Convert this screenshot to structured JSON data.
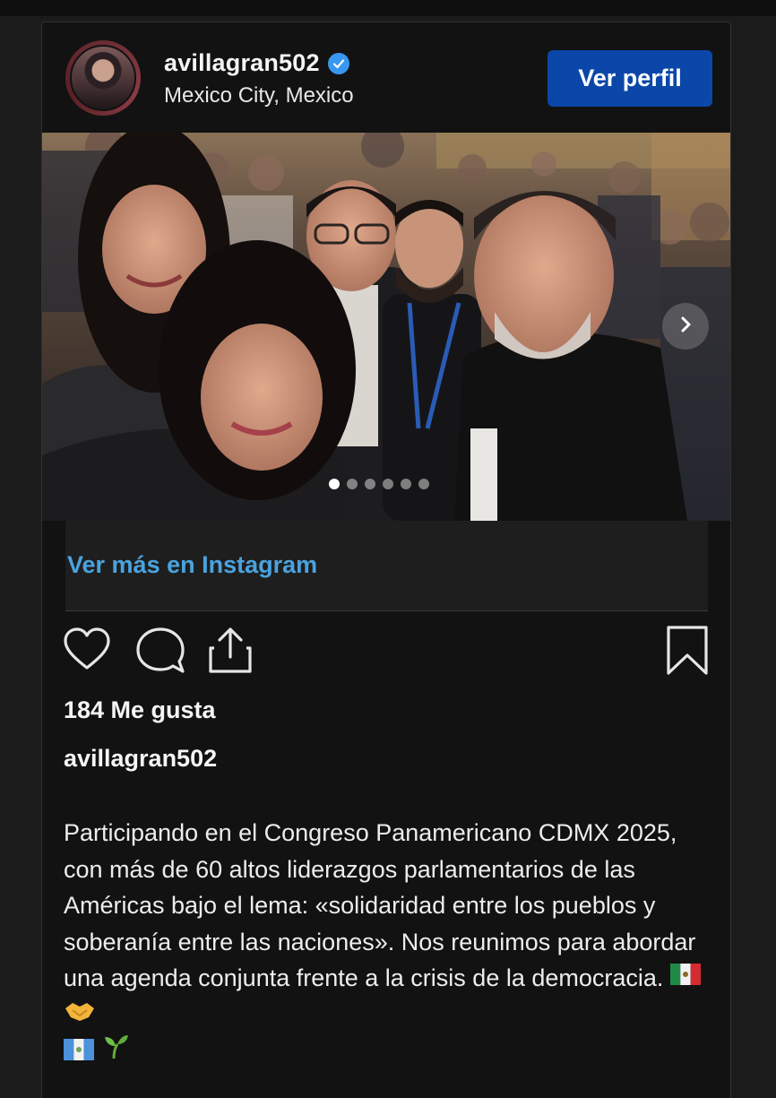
{
  "post": {
    "username": "avillagran502",
    "location": "Mexico City, Mexico",
    "view_profile_label": "Ver perfil",
    "view_more_label": "Ver más en Instagram",
    "likes_text": "184 Me gusta",
    "caption_user": "avillagran502",
    "caption_text": "Participando en el Congreso Panamericano CDMX 2025, con más de 60 altos liderazgos parlamentarios de las Américas bajo el lema: «solidaridad entre los pueblos y soberanía entre las naciones». Nos reunimos para abordar una agenda conjunta frente a la crisis de la democracia.",
    "carousel": {
      "total": 6,
      "current": 1
    },
    "verified": true,
    "icons": [
      "heart-icon",
      "comment-icon",
      "share-icon",
      "bookmark-icon",
      "chevron-right-icon",
      "verified-badge-icon"
    ],
    "emoji": [
      "mexico-flag",
      "handshake",
      "guatemala-flag",
      "seedling"
    ]
  },
  "colors": {
    "background": "#1b1b1b",
    "card": "#121212",
    "button": "#0a47a8",
    "link": "#4aa3df",
    "verified": "#3897f0"
  }
}
